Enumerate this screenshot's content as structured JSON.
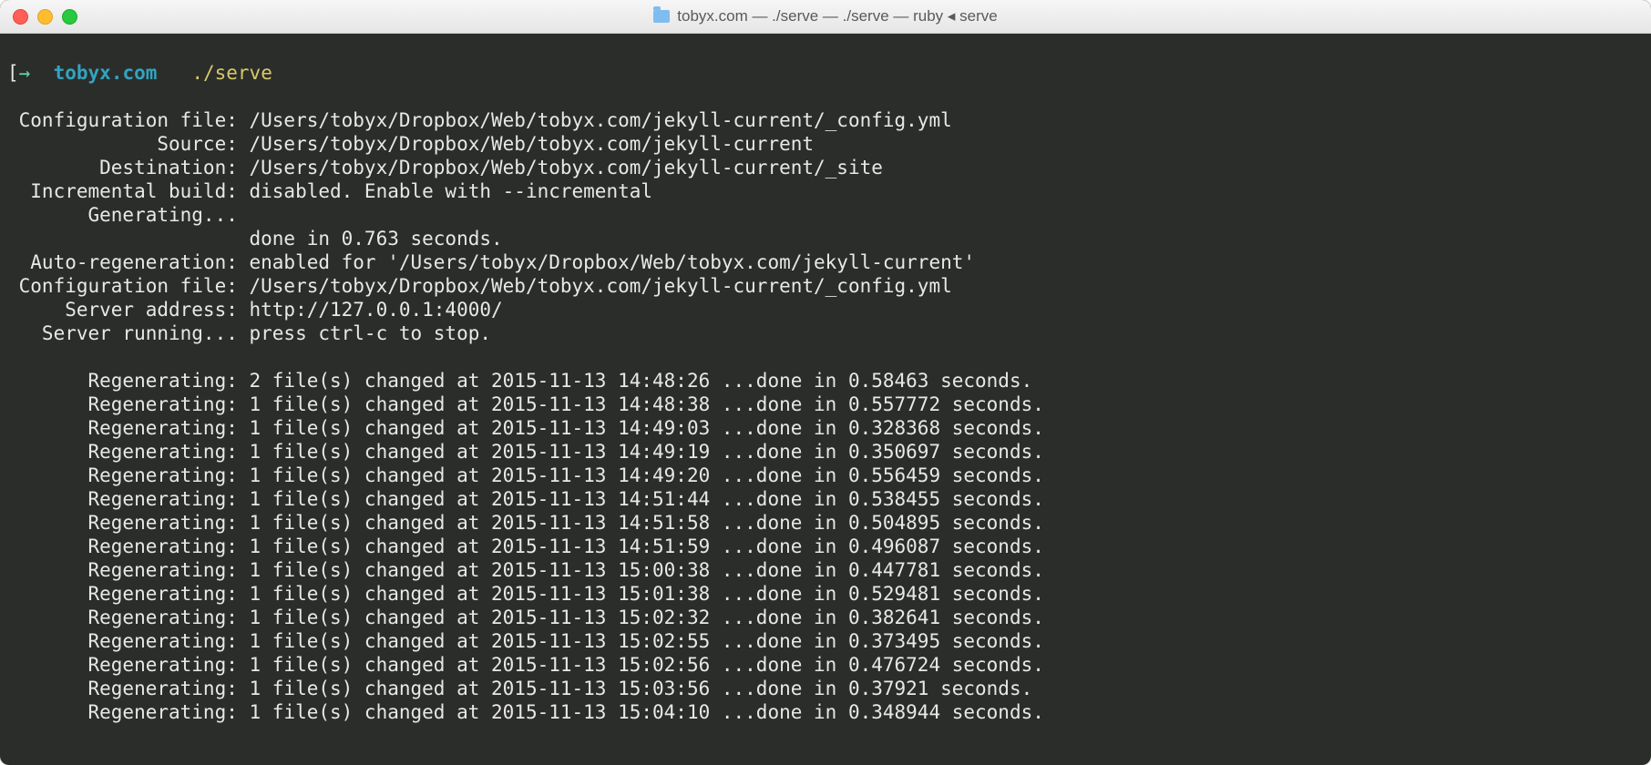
{
  "titlebar": {
    "text": "tobyx.com — ./serve — ./serve — ruby ◂ serve"
  },
  "prompt": {
    "arrow": "→",
    "cwd": "tobyx.com",
    "command": "./serve"
  },
  "info_lines": [
    {
      "label": "Configuration file:",
      "value": "/Users/tobyx/Dropbox/Web/tobyx.com/jekyll-current/_config.yml"
    },
    {
      "label": "Source:",
      "value": "/Users/tobyx/Dropbox/Web/tobyx.com/jekyll-current"
    },
    {
      "label": "Destination:",
      "value": "/Users/tobyx/Dropbox/Web/tobyx.com/jekyll-current/_site"
    },
    {
      "label": "Incremental build:",
      "value": "disabled. Enable with --incremental"
    },
    {
      "label": "Generating...",
      "value": ""
    },
    {
      "label": "",
      "value": "done in 0.763 seconds."
    },
    {
      "label": "Auto-regeneration:",
      "value": "enabled for '/Users/tobyx/Dropbox/Web/tobyx.com/jekyll-current'"
    },
    {
      "label": "Configuration file:",
      "value": "/Users/tobyx/Dropbox/Web/tobyx.com/jekyll-current/_config.yml"
    },
    {
      "label": "Server address:",
      "value": "http://127.0.0.1:4000/"
    },
    {
      "label": "Server running...",
      "value": "press ctrl-c to stop."
    }
  ],
  "regen_label": "Regenerating:",
  "regenerating": [
    {
      "files": 2,
      "at": "2015-11-13 14:48:26",
      "seconds": "0.58463"
    },
    {
      "files": 1,
      "at": "2015-11-13 14:48:38",
      "seconds": "0.557772"
    },
    {
      "files": 1,
      "at": "2015-11-13 14:49:03",
      "seconds": "0.328368"
    },
    {
      "files": 1,
      "at": "2015-11-13 14:49:19",
      "seconds": "0.350697"
    },
    {
      "files": 1,
      "at": "2015-11-13 14:49:20",
      "seconds": "0.556459"
    },
    {
      "files": 1,
      "at": "2015-11-13 14:51:44",
      "seconds": "0.538455"
    },
    {
      "files": 1,
      "at": "2015-11-13 14:51:58",
      "seconds": "0.504895"
    },
    {
      "files": 1,
      "at": "2015-11-13 14:51:59",
      "seconds": "0.496087"
    },
    {
      "files": 1,
      "at": "2015-11-13 15:00:38",
      "seconds": "0.447781"
    },
    {
      "files": 1,
      "at": "2015-11-13 15:01:38",
      "seconds": "0.529481"
    },
    {
      "files": 1,
      "at": "2015-11-13 15:02:32",
      "seconds": "0.382641"
    },
    {
      "files": 1,
      "at": "2015-11-13 15:02:55",
      "seconds": "0.373495"
    },
    {
      "files": 1,
      "at": "2015-11-13 15:02:56",
      "seconds": "0.476724"
    },
    {
      "files": 1,
      "at": "2015-11-13 15:03:56",
      "seconds": "0.37921"
    },
    {
      "files": 1,
      "at": "2015-11-13 15:04:10",
      "seconds": "0.348944"
    }
  ]
}
